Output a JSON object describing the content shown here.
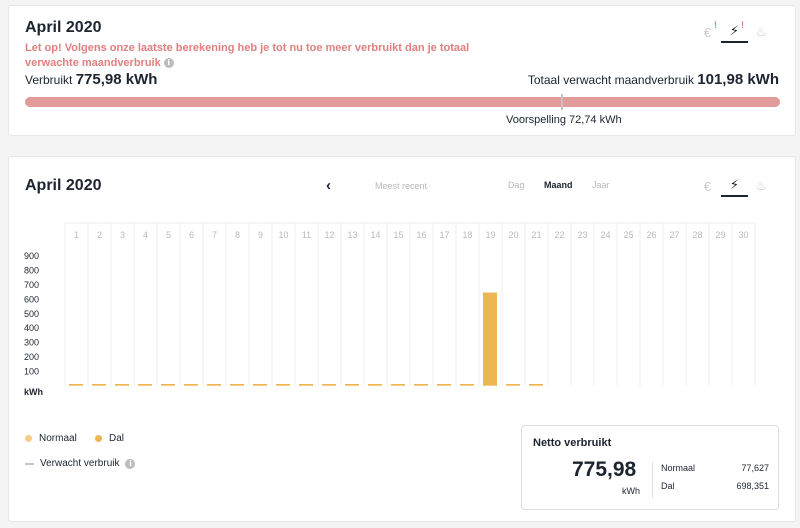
{
  "summary": {
    "title": "April 2020",
    "warning": "Let op! Volgens onze laatste berekening heb je tot nu toe meer verbruikt dan je totaal verwachte maandverbruik",
    "usage_label": "Verbruikt",
    "usage_value": "775,98 kWh",
    "expected_label": "Totaal verwacht maandverbruik",
    "expected_value": "101,98 kWh",
    "forecast_label": "Voorspelling 72,74 kWh",
    "progress_fraction": 1.0,
    "icons": [
      {
        "name": "euro-icon",
        "glyph": "€",
        "alert": "!",
        "active": false
      },
      {
        "name": "electricity-icon",
        "glyph": "⚡",
        "alert": "!",
        "active": true
      },
      {
        "name": "gas-icon",
        "glyph": "♨",
        "alert": "",
        "active": false
      }
    ]
  },
  "chart_panel": {
    "title": "April 2020",
    "prev_arrow": "‹",
    "recent_label": "Meest recent",
    "periods": [
      "Dag",
      "Maand",
      "Jaar"
    ],
    "selected_period": "Maand",
    "icons": [
      {
        "name": "euro-icon",
        "glyph": "€",
        "active": false
      },
      {
        "name": "electricity-icon",
        "glyph": "⚡",
        "active": true
      },
      {
        "name": "gas-icon",
        "glyph": "♨",
        "active": false
      }
    ],
    "legend": {
      "normaal": "Normaal",
      "dal": "Dal",
      "expected": "Verwacht verbruik"
    },
    "netto": {
      "title": "Netto verbruikt",
      "value": "775,98",
      "unit": "kWh",
      "normaal_label": "Normaal",
      "normaal_value": "77,627",
      "dal_label": "Dal",
      "dal_value": "698,351"
    }
  },
  "colors": {
    "normaal": "#f5cd86",
    "dal": "#eeb553",
    "warning": "#e07f7f",
    "progress": "#e39a9a"
  },
  "chart_data": {
    "type": "bar",
    "categories": [
      "1",
      "2",
      "3",
      "4",
      "5",
      "6",
      "7",
      "8",
      "9",
      "10",
      "11",
      "12",
      "13",
      "14",
      "15",
      "16",
      "17",
      "18",
      "19",
      "20",
      "21",
      "22",
      "23",
      "24",
      "25",
      "26",
      "27",
      "28",
      "29",
      "30"
    ],
    "series": [
      {
        "values": [
          3,
          3,
          3,
          3,
          3,
          3,
          3,
          3,
          3,
          3,
          3,
          3,
          3,
          3,
          3,
          3,
          3,
          3,
          3,
          3,
          3,
          null,
          null,
          null,
          null,
          null,
          null,
          null,
          null,
          null
        ]
      },
      {
        "values": [
          1,
          1,
          1,
          1,
          1,
          1,
          1,
          1,
          1,
          7,
          1,
          1,
          7,
          1,
          1,
          1,
          1,
          1,
          640,
          1,
          1,
          null,
          null,
          null,
          null,
          null,
          null,
          null,
          null,
          null
        ]
      }
    ],
    "y_ticks": [
      "900",
      "800",
      "700",
      "600",
      "500",
      "400",
      "300",
      "200",
      "100"
    ],
    "ylabel": "kWh",
    "ylim": [
      0,
      900
    ],
    "grid": true
  }
}
